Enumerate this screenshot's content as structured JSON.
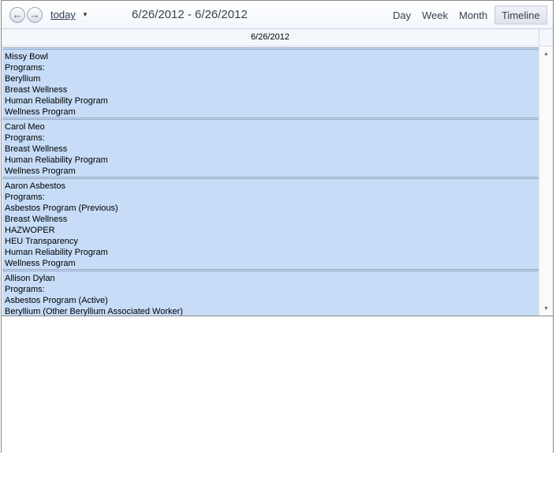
{
  "toolbar": {
    "prev_glyph": "←",
    "next_glyph": "→",
    "today_label": "today",
    "dropdown_glyph": "▼",
    "date_range": "6/26/2012 - 6/26/2012",
    "views": {
      "day": "Day",
      "week": "Week",
      "month": "Month",
      "timeline": "Timeline"
    },
    "active_view": "Timeline"
  },
  "day_header": "6/26/2012",
  "events": [
    {
      "name": "Missy Bowl",
      "programs_label": "Programs:",
      "programs": [
        "Beryllium",
        "Breast Wellness",
        "Human Reliability Program",
        "Wellness Program"
      ]
    },
    {
      "name": "Carol Meo",
      "programs_label": "Programs:",
      "programs": [
        "Breast Wellness",
        "Human Reliability Program",
        "Wellness Program"
      ]
    },
    {
      "name": "Aaron Asbestos",
      "programs_label": "Programs:",
      "programs": [
        "Asbestos Program (Previous)",
        "Breast Wellness",
        "HAZWOPER",
        "HEU Transparency",
        "Human Reliability Program",
        "Wellness Program"
      ]
    },
    {
      "name": "Allison Dylan",
      "programs_label": "Programs:",
      "programs": [
        "Asbestos Program (Active)",
        "Beryllium (Other Beryllium Associated Worker)"
      ]
    }
  ],
  "scrollbar": {
    "up_glyph": "▲",
    "down_glyph": "▼"
  },
  "colors": {
    "event_bg": "#c6dcf7",
    "event_border": "#96a9c1",
    "header_bg": "#f3f6fb"
  }
}
